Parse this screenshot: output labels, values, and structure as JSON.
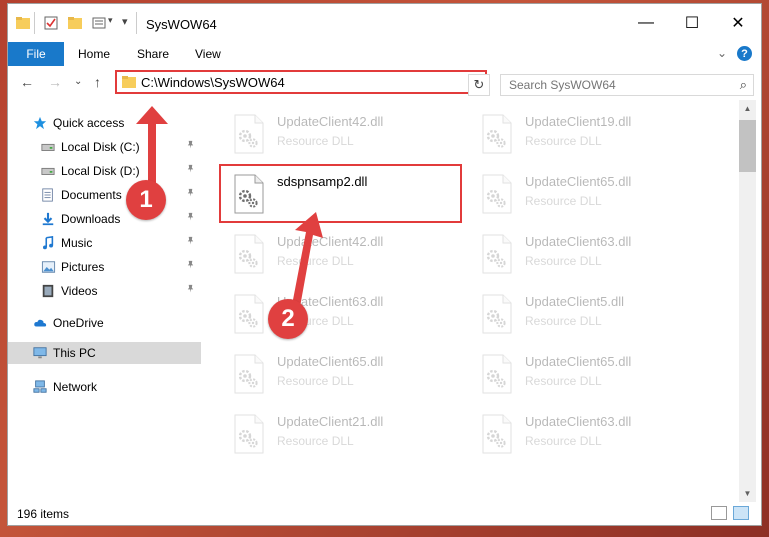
{
  "window": {
    "title": "SysWOW64",
    "controls": {
      "minimize": "—",
      "maximize": "☐",
      "close": "✕"
    }
  },
  "ribbon": {
    "tabs": [
      "File",
      "Home",
      "Share",
      "View"
    ],
    "expand": "⌄",
    "help": "?"
  },
  "nav": {
    "back": "←",
    "forward": "→",
    "recent": "⌄",
    "up": "↑",
    "address": "C:\\Windows\\SysWOW64",
    "address_dropdown": "⌄",
    "refresh": "↻",
    "search_placeholder": "Search SysWOW64",
    "search_icon": "⌕"
  },
  "sidebar": {
    "items": [
      {
        "label": "Quick access",
        "icon": "star-icon",
        "pinned": false
      },
      {
        "label": "Local Disk (C:)",
        "icon": "drive-icon",
        "pinned": true
      },
      {
        "label": "Local Disk (D:)",
        "icon": "drive-icon",
        "pinned": true
      },
      {
        "label": "Documents",
        "icon": "documents-icon",
        "pinned": true
      },
      {
        "label": "Downloads",
        "icon": "download-icon",
        "pinned": true
      },
      {
        "label": "Music",
        "icon": "music-icon",
        "pinned": true
      },
      {
        "label": "Pictures",
        "icon": "pictures-icon",
        "pinned": true
      },
      {
        "label": "Videos",
        "icon": "videos-icon",
        "pinned": true
      },
      {
        "label": "OneDrive",
        "icon": "cloud-icon",
        "pinned": false
      },
      {
        "label": "This PC",
        "icon": "computer-icon",
        "pinned": false,
        "selected": true
      },
      {
        "label": "Network",
        "icon": "network-icon",
        "pinned": false
      }
    ],
    "pin_glyph": "📌"
  },
  "files": {
    "left": [
      {
        "name": "UpdateClient42.dll",
        "type": "Resource DLL",
        "faded": true
      },
      {
        "name": "sdspnsamp2.dll",
        "type": "",
        "faded": false
      },
      {
        "name": "UpdateClient42.dll",
        "type": "Resource DLL",
        "faded": true
      },
      {
        "name": "UpdateClient63.dll",
        "type": "Resource DLL",
        "faded": true
      },
      {
        "name": "UpdateClient65.dll",
        "type": "Resource DLL",
        "faded": true
      },
      {
        "name": "UpdateClient21.dll",
        "type": "Resource DLL",
        "faded": true
      }
    ],
    "right": [
      {
        "name": "UpdateClient19.dll",
        "type": "Resource DLL",
        "faded": true
      },
      {
        "name": "UpdateClient65.dll",
        "type": "Resource DLL",
        "faded": true
      },
      {
        "name": "UpdateClient63.dll",
        "type": "Resource DLL",
        "faded": true
      },
      {
        "name": "UpdateClient5.dll",
        "type": "Resource DLL",
        "faded": true
      },
      {
        "name": "UpdateClient65.dll",
        "type": "Resource DLL",
        "faded": true
      },
      {
        "name": "UpdateClient63.dll",
        "type": "Resource DLL",
        "faded": true
      }
    ]
  },
  "status": {
    "item_count": "196 items"
  },
  "annotations": {
    "badge1": "1",
    "badge2": "2"
  },
  "colors": {
    "accent": "#1979ca",
    "annotation": "#e23b3b",
    "folder": "#f7cd5b"
  }
}
